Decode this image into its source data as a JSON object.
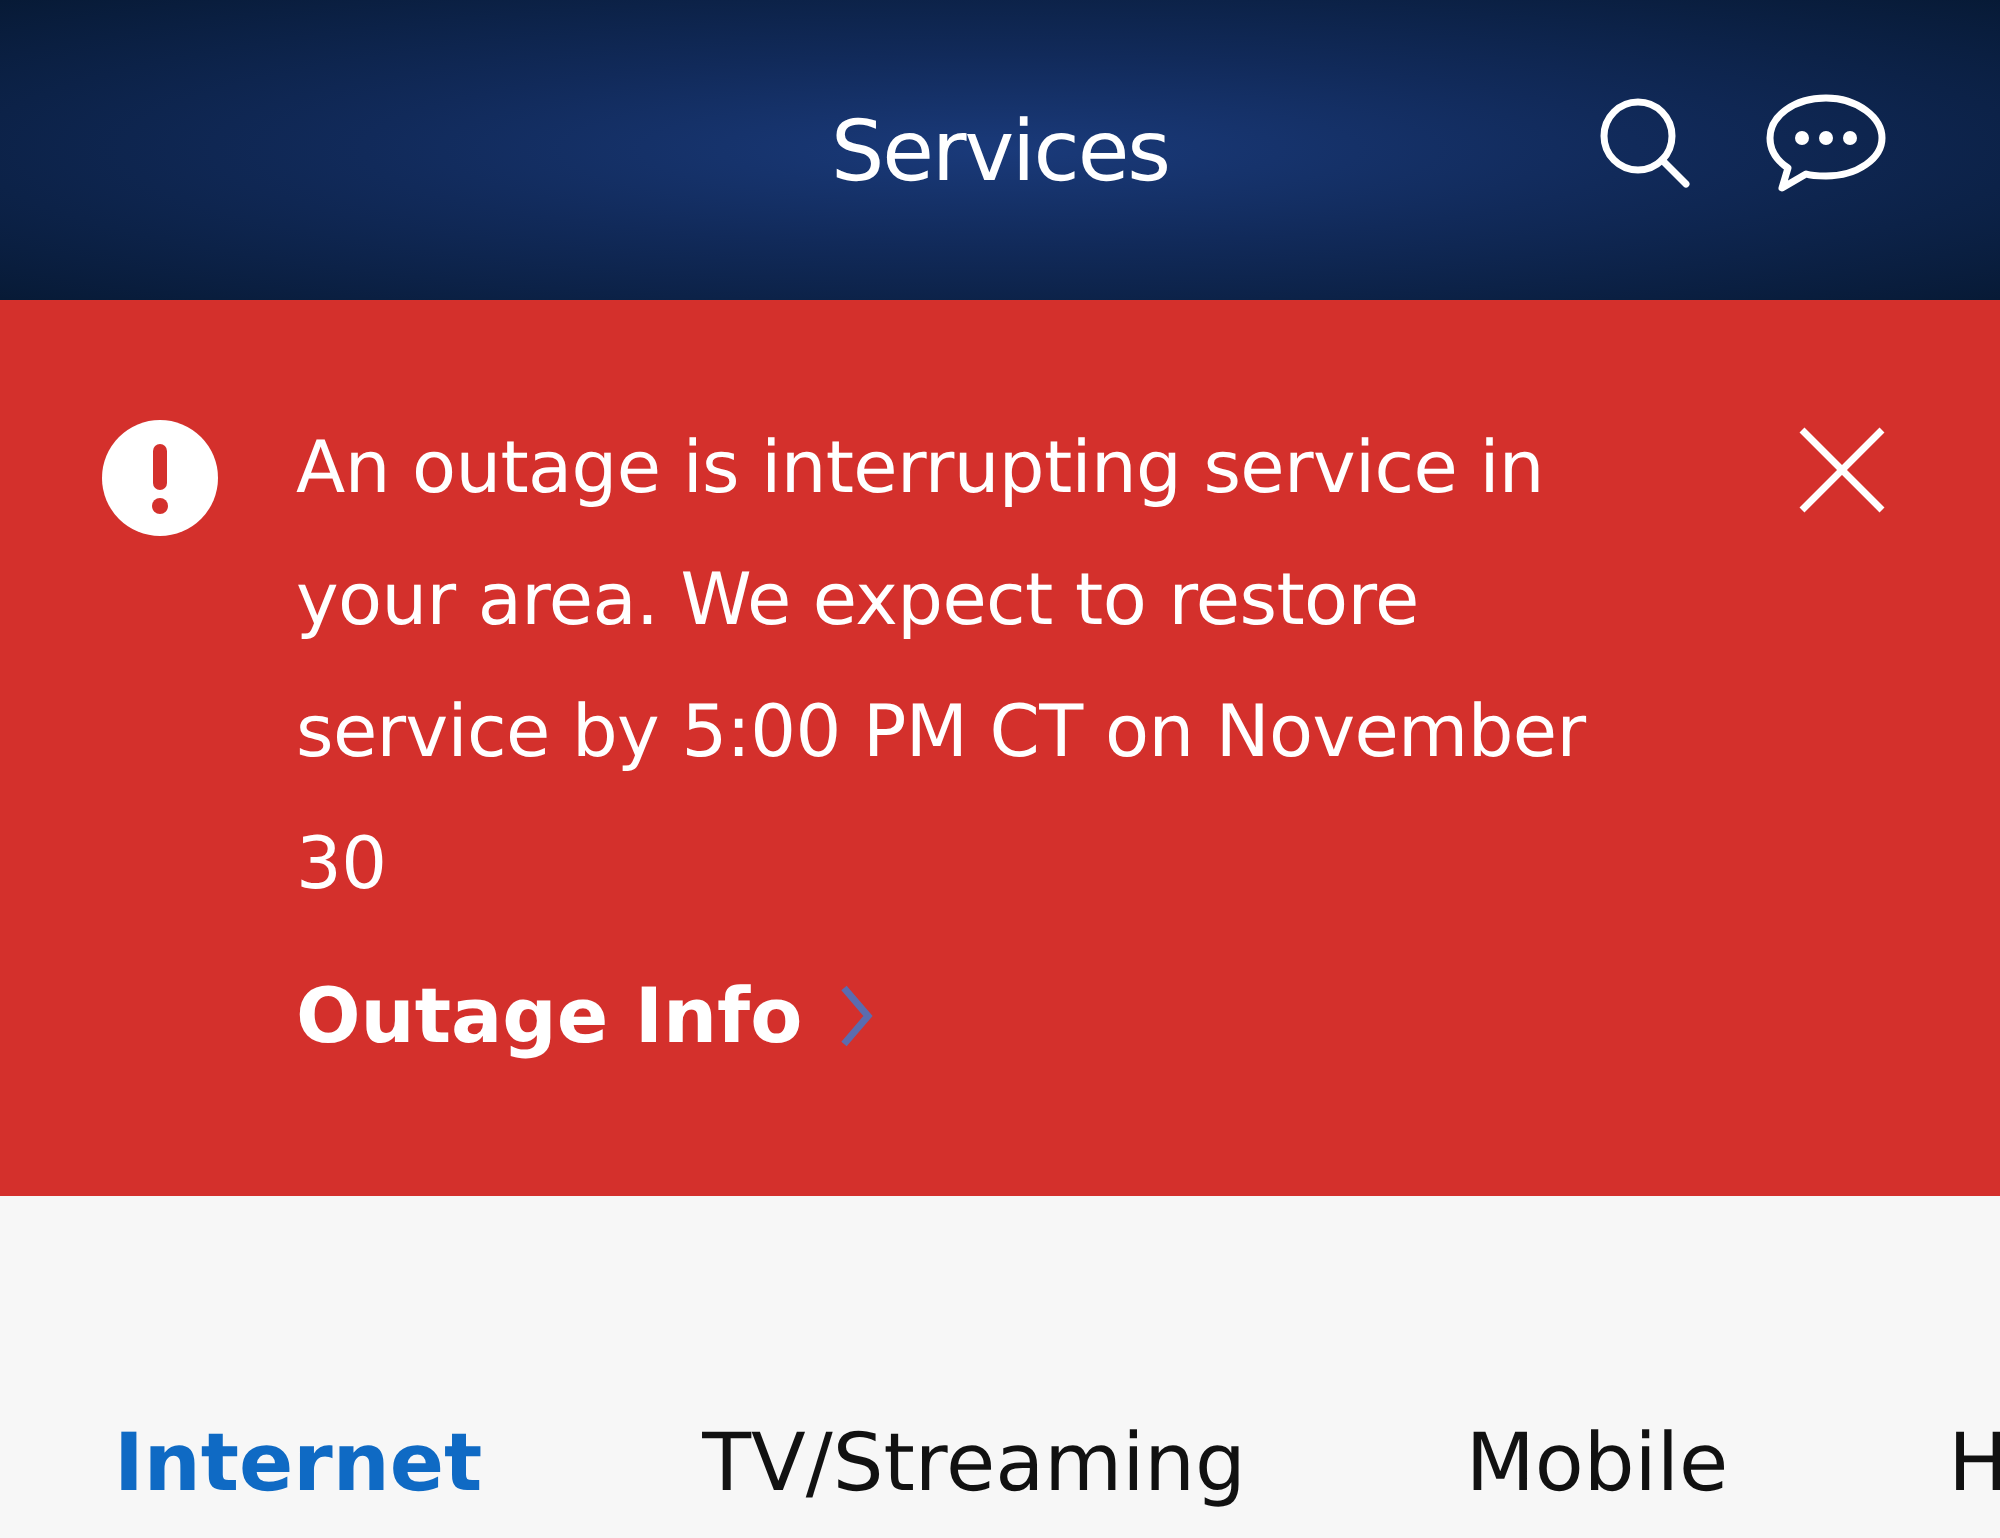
{
  "header": {
    "title": "Services"
  },
  "alert": {
    "message": "An outage is interrupting service in your area. We expect to restore service by 5:00 PM CT on November 30",
    "link": "Outage Info"
  },
  "tabs": [
    {
      "label": "Internet",
      "selected": true
    },
    {
      "label": "TV/Streaming",
      "selected": false
    },
    {
      "label": "Mobile",
      "selected": false
    },
    {
      "label": "H",
      "selected": false
    }
  ]
}
